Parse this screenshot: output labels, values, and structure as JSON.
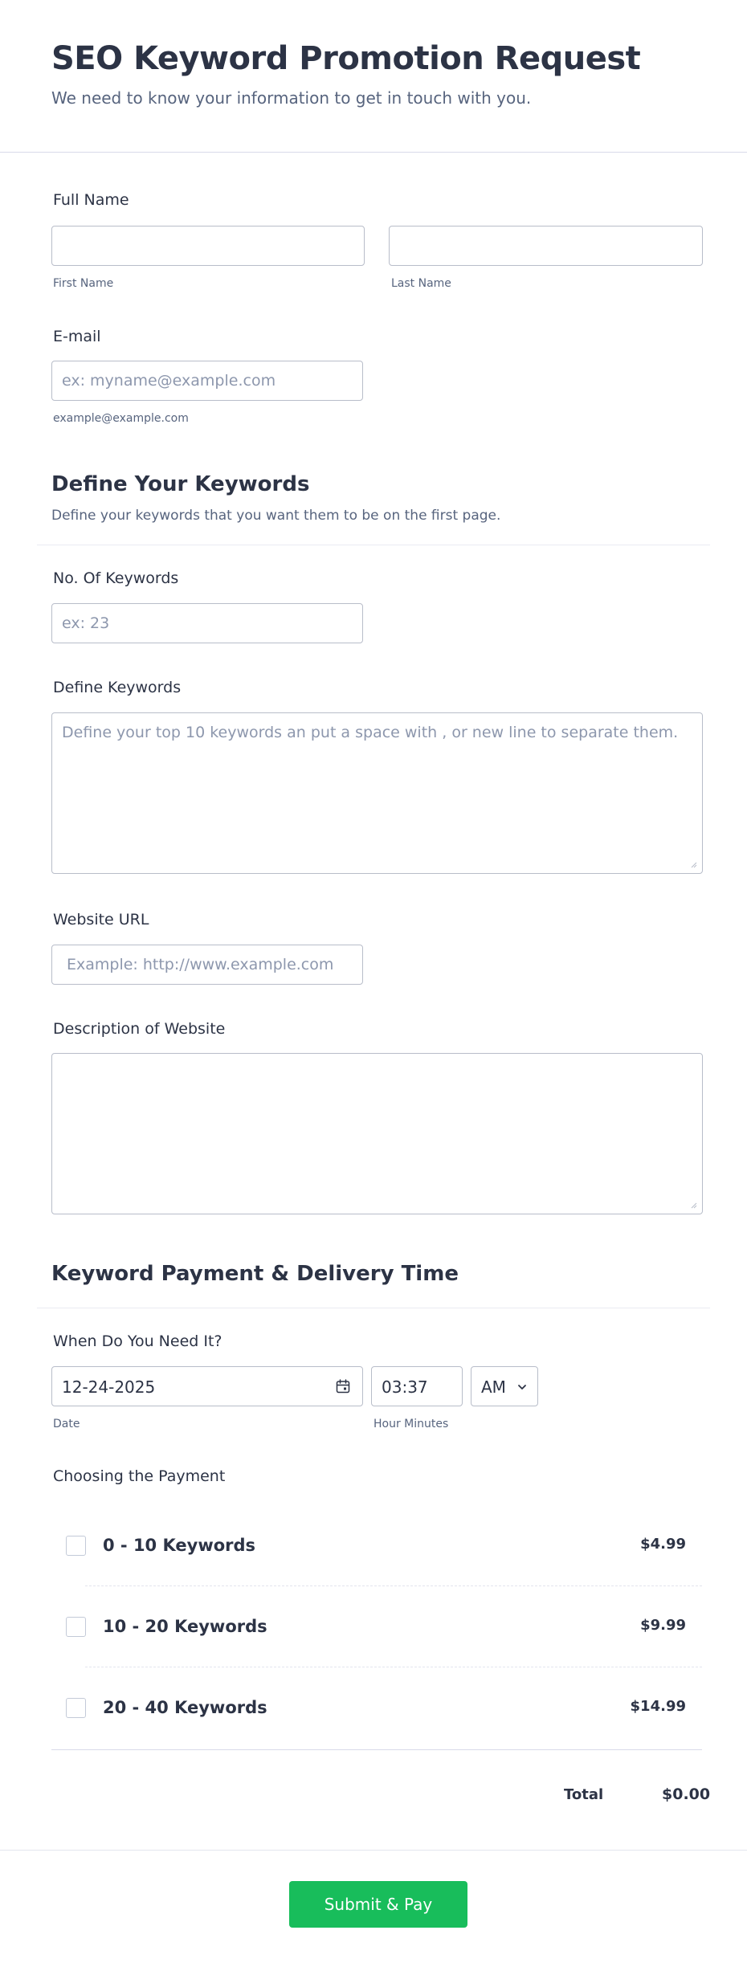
{
  "header": {
    "title": "SEO Keyword Promotion Request",
    "subtitle": "We need to know your information to get in touch with you."
  },
  "full_name": {
    "label": "Full Name",
    "first": {
      "value": "",
      "sublabel": "First Name"
    },
    "last": {
      "value": "",
      "sublabel": "Last Name"
    }
  },
  "email": {
    "label": "E-mail",
    "placeholder": "ex: myname@example.com",
    "sublabel": "example@example.com"
  },
  "keywords_section": {
    "title": "Define Your Keywords",
    "subtitle": "Define your keywords that you want them to be on the first page."
  },
  "num_keywords": {
    "label": "No. Of Keywords",
    "placeholder": "ex: 23"
  },
  "define_keywords": {
    "label": "Define Keywords",
    "placeholder": "Define your top 10 keywords an put a space with , or new line to separate them."
  },
  "website_url": {
    "label": "Website URL",
    "placeholder": "Example: http://www.example.com"
  },
  "description": {
    "label": "Description of Website",
    "value": ""
  },
  "payment_section": {
    "title": "Keyword Payment & Delivery Time"
  },
  "when": {
    "label": "When Do You Need It?",
    "date_value": "12-24-2025",
    "date_sublabel": "Date",
    "time_value": "03:37",
    "time_sublabel": "Hour Minutes",
    "ampm_value": "AM",
    "calendar_icon": "calendar-icon",
    "chevron_icon": "chevron-down-icon"
  },
  "payment": {
    "label": "Choosing the Payment",
    "options": [
      {
        "name": "0 - 10 Keywords",
        "price": "$4.99",
        "checked": false
      },
      {
        "name": "10 - 20 Keywords",
        "price": "$9.99",
        "checked": false
      },
      {
        "name": "20 - 40 Keywords",
        "price": "$14.99",
        "checked": false
      }
    ],
    "total_label": "Total",
    "total_value": "$0.00"
  },
  "submit": {
    "label": "Submit & Pay"
  },
  "colors": {
    "text": "#2c3345",
    "muted": "#57647e",
    "border": "#b8bdc9",
    "accent": "#18bd5b",
    "placeholder": "#8d97ad"
  }
}
